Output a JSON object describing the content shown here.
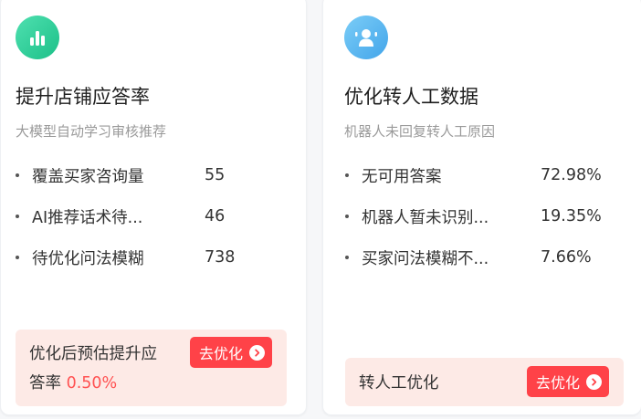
{
  "colors": {
    "accent_red": "#ff4248",
    "highlight_red": "#ff5252",
    "footer_bg": "#fdeae6",
    "green_icon": "#1cc088",
    "blue_icon": "#43a5ea"
  },
  "cards": [
    {
      "icon": "bar-chart-icon",
      "title": "提升店铺应答率",
      "subtitle": "大模型自动学习审核推荐",
      "metrics": [
        {
          "label": "覆盖买家咨询量",
          "value": "55"
        },
        {
          "label": "AI推荐话术待...",
          "value": "46"
        },
        {
          "label": "待优化问法模糊",
          "value": "738"
        }
      ],
      "footer": {
        "line1": "优化后预估提升应",
        "line2_prefix": "答率",
        "line2_value": "0.50%",
        "button_label": "去优化"
      }
    },
    {
      "icon": "robot-agent-icon",
      "title": "优化转人工数据",
      "subtitle": "机器人未回复转人工原因",
      "metrics": [
        {
          "label": "无可用答案",
          "value": "72.98%"
        },
        {
          "label": "机器人暂未识别...",
          "value": "19.35%"
        },
        {
          "label": "买家问法模糊不...",
          "value": "7.66%"
        }
      ],
      "footer": {
        "text": "转人工优化",
        "button_label": "去优化"
      }
    }
  ]
}
